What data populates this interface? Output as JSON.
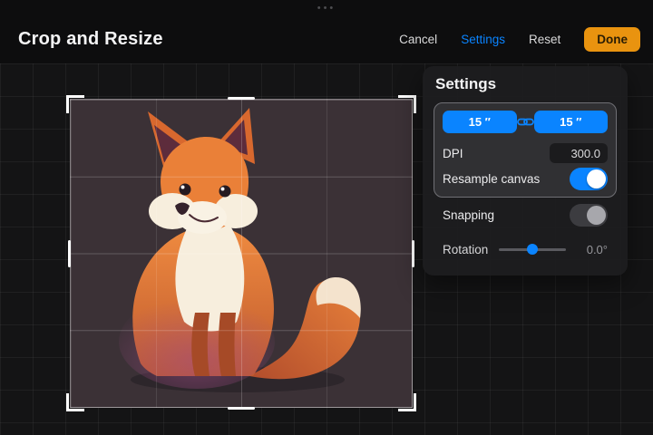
{
  "titlebar": {
    "title": "Crop and Resize",
    "handle_dots": "•••",
    "cancel_label": "Cancel",
    "settings_label": "Settings",
    "reset_label": "Reset",
    "done_label": "Done"
  },
  "settings_panel": {
    "heading": "Settings",
    "width_value": "15 ″",
    "height_value": "15 ″",
    "dpi_label": "DPI",
    "dpi_value": "300.0",
    "resample_label": "Resample canvas",
    "resample_on": true,
    "snapping_label": "Snapping",
    "snapping_on": false,
    "rotation_label": "Rotation",
    "rotation_value": "0.0°",
    "rotation_slider_percent": 50
  },
  "canvas": {
    "content": "fox-illustration",
    "background_color": "#3B3136",
    "grid_divisions": 4
  },
  "colors": {
    "accent_blue": "#0A84FF",
    "done_button": "#E9930F",
    "toggle_off_track": "#3C3C40",
    "panel_background": "#1D1D1F"
  },
  "icons": {
    "link": "link-icon"
  }
}
